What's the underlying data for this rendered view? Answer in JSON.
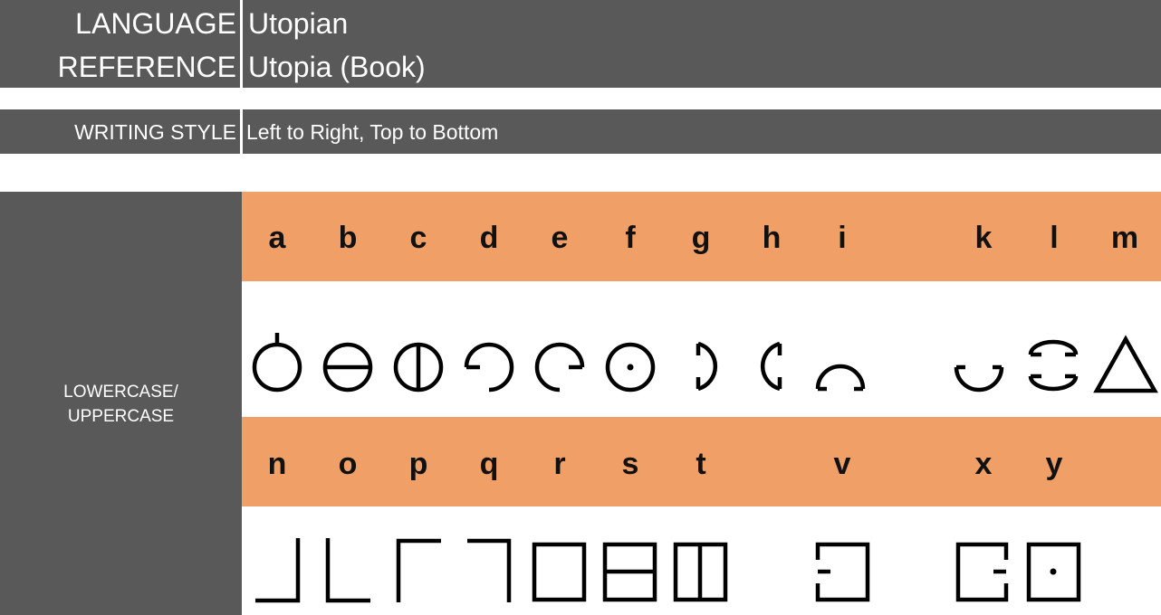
{
  "header": {
    "language_label": "LANGUAGE",
    "language_value": "Utopian",
    "reference_label": "REFERENCE",
    "reference_value": "Utopia (Book)"
  },
  "writing_style": {
    "label": "WRITING STYLE",
    "value": "Left to Right, Top to Bottom"
  },
  "alphabet": {
    "section_label_line1": "LOWERCASE/",
    "section_label_line2": "UPPERCASE",
    "row1_letters": [
      "a",
      "b",
      "c",
      "d",
      "e",
      "f",
      "g",
      "h",
      "i",
      "",
      "k",
      "l",
      "m"
    ],
    "row2_letters": [
      "n",
      "o",
      "p",
      "q",
      "r",
      "s",
      "t",
      "",
      "v",
      "",
      "x",
      "y",
      ""
    ]
  },
  "colors": {
    "band": "#595959",
    "accent": "#f0a066"
  }
}
